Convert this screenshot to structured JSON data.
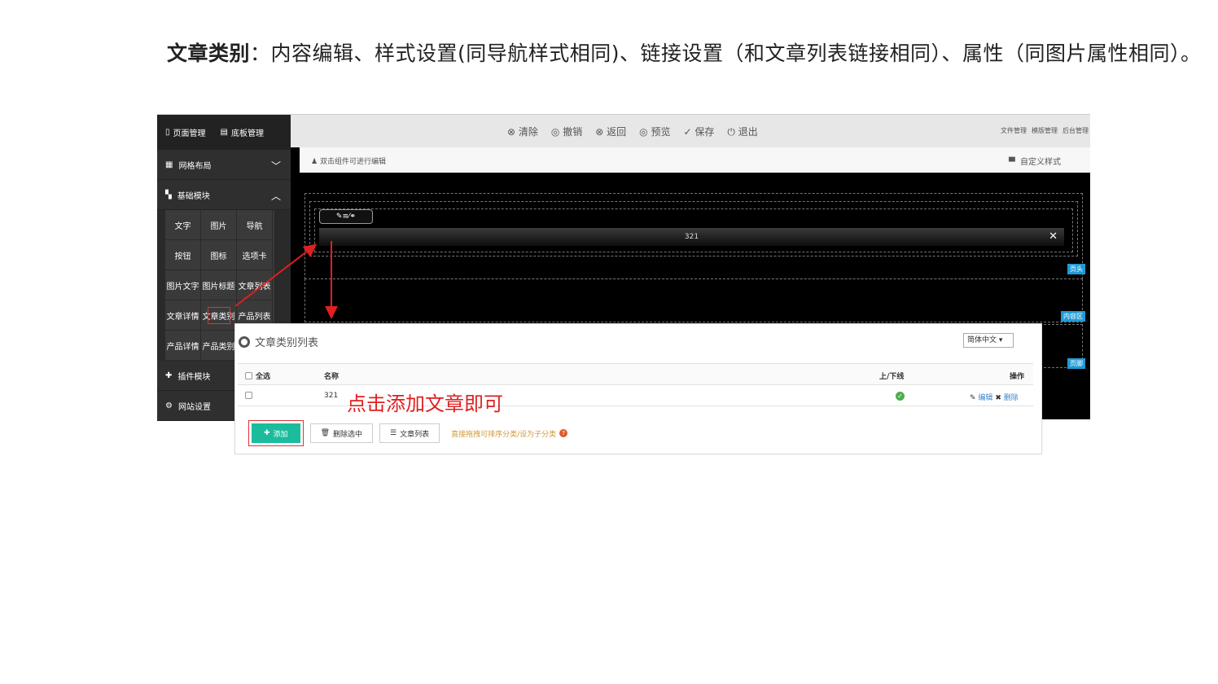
{
  "heading": {
    "bold": "文章类别",
    "rest": "：内容编辑、样式设置(同导航样式相同)、链接设置（和文章列表链接相同）、属性（同图片属性相同）。"
  },
  "sidebar": {
    "top": [
      "页面管理",
      "底板管理"
    ],
    "sections": {
      "grid_layout": "网格布局",
      "basic_modules": "基础模块",
      "plugin_modules": "插件模块",
      "site_settings": "网站设置"
    },
    "modules": [
      "文字",
      "图片",
      "导航",
      "按钮",
      "图标",
      "选项卡",
      "图片文字",
      "图片标题",
      "文章列表",
      "文章详情",
      "文章类别",
      "产品列表",
      "产品详情",
      "产品类别"
    ]
  },
  "toolbar": {
    "actions": [
      "清除",
      "撤销",
      "返回",
      "预览",
      "保存",
      "退出"
    ],
    "right": [
      "文件管理",
      "模版管理",
      "后台管理"
    ]
  },
  "hint": {
    "left": "双击组件可进行编辑",
    "right": "自定义样式"
  },
  "canvas": {
    "widget_text": "321",
    "zones": [
      "页头",
      "内容区",
      "页脚"
    ]
  },
  "panel": {
    "title": "文章类别列表",
    "language": "简体中文",
    "columns": {
      "select_all": "全选",
      "name": "名称",
      "status": "上/下线",
      "ops": "操作"
    },
    "rows": [
      {
        "name": "321",
        "edit": "编辑",
        "delete": "删除"
      }
    ],
    "annotation": "点击添加文章即可",
    "buttons": {
      "add": "添加",
      "delete_selected": "删除选中",
      "article_list": "文章列表"
    },
    "note": "直接拖拽可排序分类/设为子分类"
  }
}
